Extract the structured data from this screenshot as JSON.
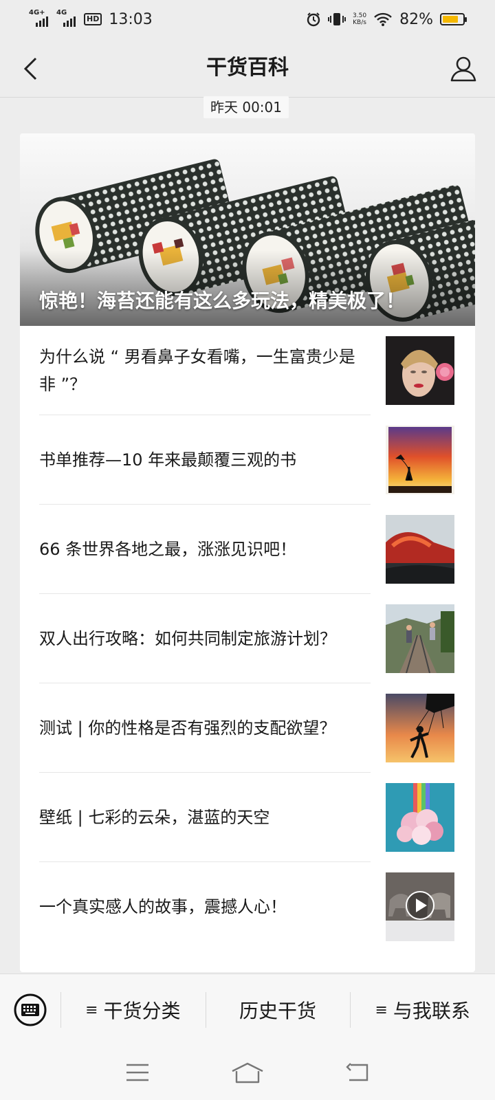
{
  "status_bar": {
    "net1": "4G+",
    "net2": "4G",
    "hd": "HD",
    "time": "13:03",
    "speed_value": "3.50",
    "speed_unit": "KB/s",
    "battery": "82%",
    "battery_level": 0.82,
    "battery_color": "#f5b800"
  },
  "nav": {
    "title": "干货百科",
    "back_icon": "chevron-left-icon",
    "profile_icon": "person-icon"
  },
  "timestamp": "昨天 00:01",
  "hero": {
    "title": "惊艳！海苔还能有这么多玩法，精美极了！",
    "image": "sushi-rolls-image"
  },
  "articles": [
    {
      "title": "为什么说 “ 男看鼻子女看嘴，一生富贵少是非 ”？",
      "thumb": "woman-portrait-rose-image"
    },
    {
      "title": "书单推荐—10 年来最颠覆三观的书",
      "thumb": "kite-runner-book-cover-image"
    },
    {
      "title": "66 条世界各地之最，涨涨见识吧！",
      "thumb": "lava-flow-image"
    },
    {
      "title": "双人出行攻略：如何共同制定旅游计划？",
      "thumb": "couple-railway-image"
    },
    {
      "title": "测试 | 你的性格是否有强烈的支配欲望？",
      "thumb": "puppet-hand-sunset-image"
    },
    {
      "title": "壁纸 | 七彩的云朵，湛蓝的天空",
      "thumb": "rainbow-cloud-image"
    },
    {
      "title": "一个真实感人的故事，震撼人心！",
      "thumb": "wolves-video-image"
    }
  ],
  "bottom_menu": {
    "keyboard_icon": "keyboard-icon",
    "items": [
      {
        "label": "干货分类",
        "has_submenu": true
      },
      {
        "label": "历史干货",
        "has_submenu": false
      },
      {
        "label": "与我联系",
        "has_submenu": true
      }
    ],
    "submenu_glyph": "≡"
  },
  "system_nav": [
    "menu-icon",
    "home-icon",
    "back-icon"
  ]
}
